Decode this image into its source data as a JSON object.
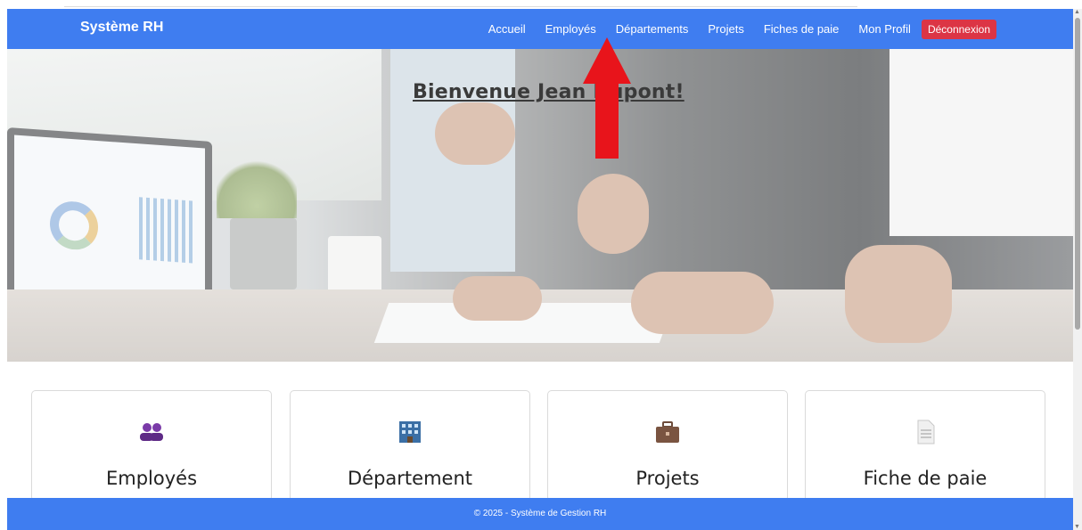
{
  "navbar": {
    "brand": "Système RH",
    "links": [
      "Accueil",
      "Employés",
      "Départements",
      "Projets",
      "Fiches de paie",
      "Mon Profil"
    ],
    "logout": "Déconnexion",
    "color": "#3f7df0",
    "logout_color": "#dc3545"
  },
  "hero": {
    "title": "Bienvenue Jean Dupont!"
  },
  "annotation": {
    "arrow_color": "#e8141b",
    "arrow_icon": "up-arrow-icon"
  },
  "cards": [
    {
      "title": "Employés",
      "icon": "people-icon"
    },
    {
      "title": "Département",
      "icon": "building-icon"
    },
    {
      "title": "Projets",
      "icon": "briefcase-icon"
    },
    {
      "title": "Fiche de paie",
      "icon": "document-icon"
    }
  ],
  "footer": {
    "text": "© 2025 - Système de Gestion RH"
  }
}
